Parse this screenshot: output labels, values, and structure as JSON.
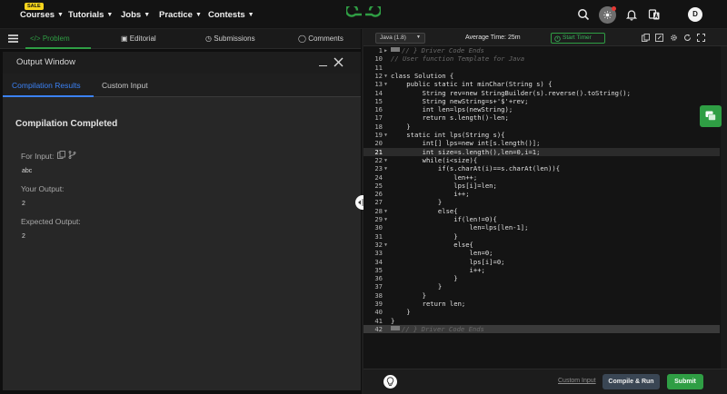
{
  "nav": {
    "sale_badge": "SALE",
    "items": [
      "Courses",
      "Tutorials",
      "Jobs",
      "Practice",
      "Contests"
    ],
    "avatar_initial": "D"
  },
  "problem_tabs": [
    "Problem",
    "Editorial",
    "Submissions",
    "Comments"
  ],
  "output_window": {
    "title": "Output Window",
    "tabs": [
      "Compilation Results",
      "Custom Input"
    ],
    "status": "Compilation Completed",
    "for_input_label": "For Input:",
    "input_value": "abc",
    "your_output_label": "Your Output:",
    "your_output_value": "2",
    "expected_output_label": "Expected Output:",
    "expected_output_value": "2"
  },
  "editor": {
    "language": "Java (1.8)",
    "average_time": "Average Time: 25m",
    "timer_label": "Start Timer",
    "custom_input_link": "Custom Input",
    "compile_label": "Compile & Run",
    "submit_label": "Submit",
    "lines": [
      {
        "n": "1",
        "t": "// } Driver Code Ends",
        "kind": "fold-start"
      },
      {
        "n": "10",
        "t": "// User function Template for Java",
        "kind": "comment"
      },
      {
        "n": "11",
        "t": "",
        "kind": "code"
      },
      {
        "n": "12",
        "t": "class Solution {",
        "kind": "code",
        "fold": true
      },
      {
        "n": "13",
        "t": "    public static int minChar(String s) {",
        "kind": "code",
        "fold": true
      },
      {
        "n": "14",
        "t": "        String rev=new StringBuilder(s).reverse().toString();",
        "kind": "code"
      },
      {
        "n": "15",
        "t": "        String newString=s+'$'+rev;",
        "kind": "code"
      },
      {
        "n": "16",
        "t": "        int len=lps(newString);",
        "kind": "code"
      },
      {
        "n": "17",
        "t": "        return s.length()-len;",
        "kind": "code"
      },
      {
        "n": "18",
        "t": "    }",
        "kind": "code"
      },
      {
        "n": "19",
        "t": "    static int lps(String s){",
        "kind": "code",
        "fold": true
      },
      {
        "n": "20",
        "t": "        int[] lps=new int[s.length()];",
        "kind": "code"
      },
      {
        "n": "21",
        "t": "        int size=s.length(),len=0,i=1;",
        "kind": "code",
        "current": true
      },
      {
        "n": "22",
        "t": "        while(i<size){",
        "kind": "code",
        "fold": true
      },
      {
        "n": "23",
        "t": "            if(s.charAt(i)==s.charAt(len)){",
        "kind": "code",
        "fold": true
      },
      {
        "n": "24",
        "t": "                len++;",
        "kind": "code"
      },
      {
        "n": "25",
        "t": "                lps[i]=len;",
        "kind": "code"
      },
      {
        "n": "26",
        "t": "                i++;",
        "kind": "code"
      },
      {
        "n": "27",
        "t": "            }",
        "kind": "code"
      },
      {
        "n": "28",
        "t": "            else{",
        "kind": "code",
        "fold": true
      },
      {
        "n": "29",
        "t": "                if(len!=0){",
        "kind": "code",
        "fold": true
      },
      {
        "n": "30",
        "t": "                    len=lps[len-1];",
        "kind": "code"
      },
      {
        "n": "31",
        "t": "                }",
        "kind": "code"
      },
      {
        "n": "32",
        "t": "                else{",
        "kind": "code",
        "fold": true
      },
      {
        "n": "33",
        "t": "                    len=0;",
        "kind": "code"
      },
      {
        "n": "34",
        "t": "                    lps[i]=0;",
        "kind": "code"
      },
      {
        "n": "35",
        "t": "                    i++;",
        "kind": "code"
      },
      {
        "n": "36",
        "t": "                }",
        "kind": "code"
      },
      {
        "n": "37",
        "t": "            }",
        "kind": "code"
      },
      {
        "n": "38",
        "t": "        }",
        "kind": "code"
      },
      {
        "n": "39",
        "t": "        return len;",
        "kind": "code"
      },
      {
        "n": "40",
        "t": "    }",
        "kind": "code"
      },
      {
        "n": "41",
        "t": "}",
        "kind": "code"
      },
      {
        "n": "42",
        "t": "// } Driver Code Ends",
        "kind": "fold-end"
      }
    ]
  },
  "colors": {
    "accent_green": "#2f9e44",
    "accent_blue": "#3b82f6",
    "background": "#0f0f0f"
  },
  "icons": [
    "hamburger-menu-icon",
    "search-icon",
    "theme-toggle-icon",
    "bell-icon",
    "translate-icon",
    "copy-icon",
    "branch-icon",
    "close-icon",
    "timer-icon",
    "lightbulb-icon",
    "split-handle-icon"
  ]
}
